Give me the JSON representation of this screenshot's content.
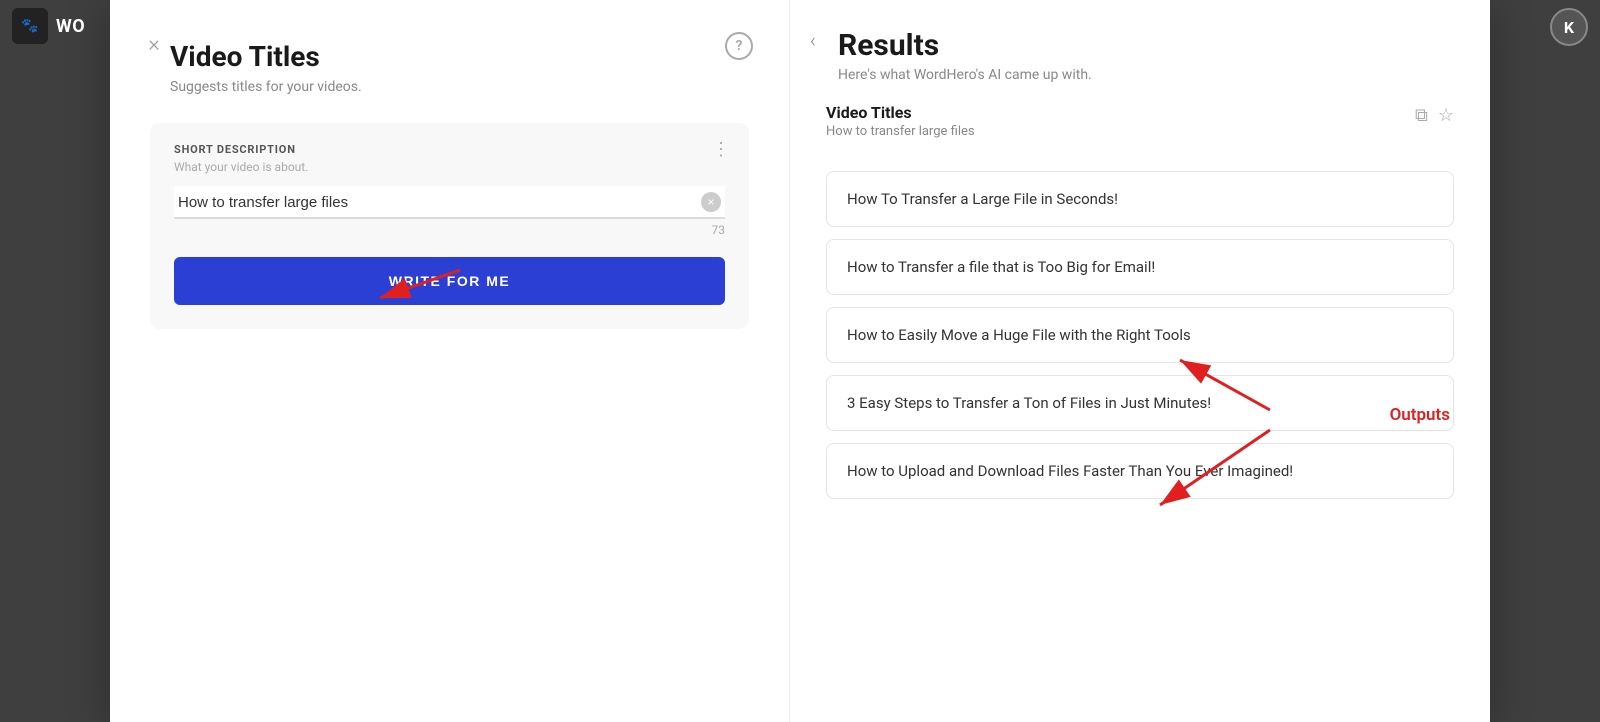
{
  "app": {
    "name": "WO",
    "avatar_initial": "K"
  },
  "left_panel": {
    "close_label": "×",
    "title": "Video Titles",
    "subtitle": "Suggests titles for your videos.",
    "help_label": "?",
    "form": {
      "menu_dots": "⋮",
      "field_label": "SHORT DESCRIPTION",
      "field_hint": "What your video is about.",
      "input_value": "How to transfer large files",
      "input_placeholder": "What your video is about.",
      "char_count": "73",
      "clear_label": "×",
      "write_btn_label": "WRITE FOR ME"
    }
  },
  "right_panel": {
    "back_label": "‹",
    "results_title": "Results",
    "results_subtitle": "Here's what WordHero's AI came up with.",
    "section_title": "Video Titles",
    "section_subtitle": "How to transfer large files",
    "copy_icon": "⧉",
    "star_icon": "☆",
    "outputs_annotation": "Outputs",
    "results": [
      {
        "id": 1,
        "text": "How To Transfer a Large File in Seconds!"
      },
      {
        "id": 2,
        "text": "How to Transfer a file that is Too Big for Email!"
      },
      {
        "id": 3,
        "text": "How to Easily Move a Huge File with the Right Tools"
      },
      {
        "id": 4,
        "text": "3 Easy Steps to Transfer a Ton of Files in Just Minutes!"
      },
      {
        "id": 5,
        "text": "How to Upload and Download Files Faster Than You Ever Imagined!"
      }
    ]
  },
  "colors": {
    "write_btn_bg": "#2b3fd4",
    "annotation_red": "#e02020"
  }
}
